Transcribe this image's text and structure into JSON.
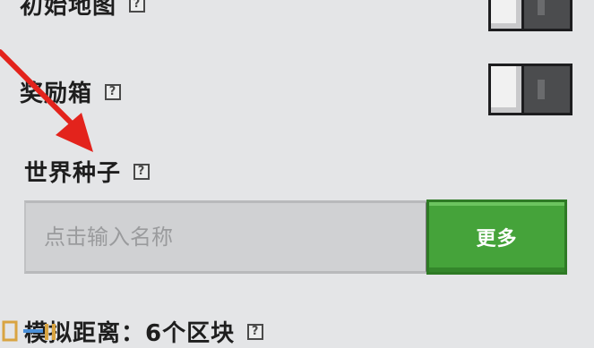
{
  "settings": {
    "initial_map": {
      "label": "初始地图",
      "help": "?",
      "state": "off"
    },
    "bonus_chest": {
      "label": "奖励箱",
      "help": "?",
      "state": "off"
    },
    "world_seed": {
      "label": "世界种子",
      "help": "?",
      "placeholder": "点击输入名称",
      "button_label": "更多"
    },
    "simulation_distance": {
      "label": "模拟距离：6个区块",
      "help": "?"
    }
  },
  "annotation": {
    "arrow_color": "#e3231c"
  }
}
